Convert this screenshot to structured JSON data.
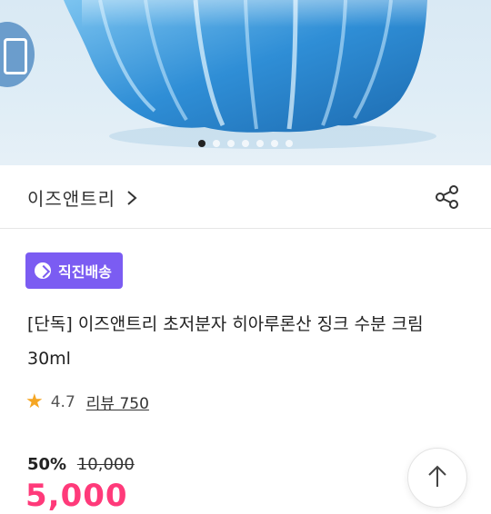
{
  "product": {
    "brand": "이즈앤트리",
    "badge": "직진배송",
    "title": "[단독] 이즈앤트리 초저분자 히아루론산 징크 수분 크림 30ml",
    "rating": "4.7",
    "reviews": "리뷰 750",
    "discount": "50%",
    "original_price": "10,000",
    "sale_price": "5,000"
  },
  "carousel": {
    "total": 7,
    "current": 1
  },
  "icons": {
    "brand_chevron": "chevron-right-icon",
    "share": "share-icon",
    "star": "star-icon",
    "scroll_top": "arrow-up-icon"
  },
  "colors": {
    "badge": "#7b5cf2",
    "sale": "#ff3a7a",
    "star": "#f5a623"
  }
}
